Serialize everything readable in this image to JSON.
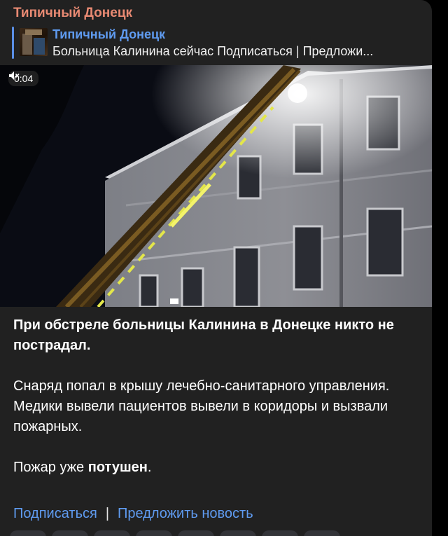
{
  "channel": {
    "name": "Типичный Донецк"
  },
  "reply": {
    "title": "Типичный Донецк",
    "text": "Больница Калинина сейчас  Подписаться  |  Предложи..."
  },
  "video": {
    "timecode": "0:04",
    "muted": true
  },
  "post": {
    "headline": "При обстреле больницы Калинина в Донецке никто не пострадал.",
    "paragraph": "Снаряд попал в крышу лечебно-санитарного управления. Медики вывели пациентов вывели в коридоры и вызвали пожарных.",
    "fire_prefix": "Пожар уже ",
    "fire_bold": "потушен",
    "fire_suffix": "."
  },
  "links": {
    "subscribe": "Подписаться",
    "separator": "|",
    "suggest": "Предложить новость"
  },
  "colors": {
    "channel_name": "#e98a73",
    "link": "#5f9bf0",
    "bubble": "#212121"
  }
}
